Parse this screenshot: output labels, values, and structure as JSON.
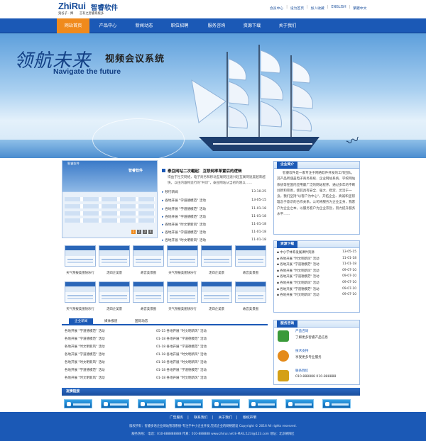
{
  "header": {
    "logo_en": "ZhiRui",
    "logo_cn": "智睿软件",
    "slogan": "鬼谷子 · 捭　　言有之智睿系统多",
    "top_links": [
      "会员中心",
      "设为首页",
      "加入收藏",
      "ENGLISH",
      "繁體中文"
    ]
  },
  "nav": {
    "items": [
      "网站首页",
      "产品中心",
      "新闻动态",
      "职位招聘",
      "服务咨询",
      "资源下载",
      "关于我们"
    ],
    "active_index": 0,
    "colors": {
      "bar": "#1b59b6",
      "active": "#f08a1c"
    }
  },
  "banner": {
    "calligraphy": "领航未来",
    "english": "Navigate the future",
    "title_cn": "视频会议系统"
  },
  "showcase": {
    "title": "智睿软件",
    "badge": "智睿软件",
    "dots": [
      "1",
      "2",
      "3",
      "4"
    ]
  },
  "news": {
    "headline": "泰豆网站二次崛起：互联网率革置后的逻辑",
    "summary": "得益于社交网络，电子商务和移动互联网迅速兴起互联网速度越来越快，以往内容构造行的\"共识\"，泰豆网站从当初的晓以……",
    "items": [
      {
        "title": "移行新闻",
        "date": "13-10-25"
      },
      {
        "title": "各地开展 \"学道德模范\" 活动",
        "date": "13-05-15"
      },
      {
        "title": "各地开展 \"学道德模范\" 活动",
        "date": "11-01-18"
      },
      {
        "title": "各地开展 \"学道德模范\" 活动",
        "date": "11-01-18"
      },
      {
        "title": "各地开展 \"时文明新风\" 活动",
        "date": "11-01-18"
      },
      {
        "title": "各地开展 \"学道德模范\" 活动",
        "date": "11-01-18"
      },
      {
        "title": "各地开展 \"时文明新风\" 活动",
        "date": "11-01-18"
      }
    ]
  },
  "sidebar": {
    "intro": {
      "title": "企业简介",
      "text": "智睿软件是一家专注于网络软件开发的工作团队，其产品所涵盖电子商务系统、企业网站系统、学校网站系统等在国内应用最广泛的网站程序，通过多年的不断创新和完善，使其具有安全、强大、稳定、灵活于一身。我们坚持\"以客户为中心\"，开拓企业、真诚和坚韧理念于意识的合作关系。公司将服务为企业全身，我客户为企业之本，以服务客户为企业宗旨，努力提升服务水平……"
    },
    "downloads": {
      "title": "资源下载",
      "items": [
        {
          "title": "中小学体育发展课件资源",
          "date": "13-05-15"
        },
        {
          "title": "各地开展 \"时文明新风\" 活动",
          "date": "11-01-18"
        },
        {
          "title": "各地开展 \"学道德模范\" 活动",
          "date": "11-01-18"
        },
        {
          "title": "各地开展 \"时文明新风\" 活动",
          "date": "09-07-10"
        },
        {
          "title": "各地开展 \"学道德模范\" 活动",
          "date": "09-07-10"
        },
        {
          "title": "各地开展 \"时文明新风\" 活动",
          "date": "09-07-10"
        },
        {
          "title": "各地开展 \"学道德模范\" 活动",
          "date": "09-07-10"
        },
        {
          "title": "各地开展 \"时文明新风\" 活动",
          "date": "09-07-10"
        }
      ]
    },
    "service": {
      "title": "服务咨询",
      "items": [
        {
          "title": "产品咨询",
          "sub": "了解更多智睿产品信息",
          "color": "#3a9a3a"
        },
        {
          "title": "技术支持",
          "sub": "享受更多专业服务",
          "color": "#e48a1a"
        },
        {
          "title": "联系我们",
          "sub": "010-888888 010-888888",
          "color": "#d4a017"
        }
      ]
    }
  },
  "gallery": {
    "row1": [
      "天气预报美图快乐行",
      "走四企美景",
      "故宫美景图",
      "天气预报美图快乐行",
      "走四企美景",
      "故宫美景图"
    ],
    "row2": [
      "天气预报美图快乐行",
      "走四企美景",
      "故宫美景图",
      "天气预报美图快乐行",
      "走四企美景",
      "故宫美景图"
    ]
  },
  "tabs": {
    "items": [
      "企业新闻",
      "媒体报道",
      "国际动态"
    ],
    "active_index": 0,
    "left": [
      "各地开展 \"学道德模范\" 活动",
      "各地开展 \"学道德模范\" 活动",
      "各地开展 \"时文明新风\" 活动",
      "各地开展 \"学道德模范\" 活动",
      "各地开展 \"时文明新风\" 活动",
      "各地开展 \"学道德模范\" 活动",
      "各地开展 \"时文明新风\" 活动"
    ],
    "right": [
      "05-15 各地开展 \"时文明新风\" 活动",
      "01-18 各地开展 \"学道德模范\" 活动",
      "01-18 各地开展 \"学道德模范\" 活动",
      "01-18 各地开展 \"时文明新风\" 活动",
      "01-18 各地开展 \"时文明新风\" 活动",
      "01-18 各地开展 \"学道德模范\" 活动",
      "01-18 各地开展 \"时文明新风\" 活动"
    ]
  },
  "friend_links": {
    "title": "友情链接",
    "count": 8
  },
  "footer": {
    "links": [
      "广告服务",
      "联系我们",
      "关于我们",
      "版权声明"
    ],
    "line1": "版权所有：智睿多语企业网站管理系统-专注于中小企业开发,完成企业的网络建设 Copyright © 2016 All rights reserved.",
    "line2": "服务热线： 电话：010-888888888  传真：010-888888 www.zhirui.net E-MAIL:123i@123.com 地址：北京朝阳区"
  }
}
